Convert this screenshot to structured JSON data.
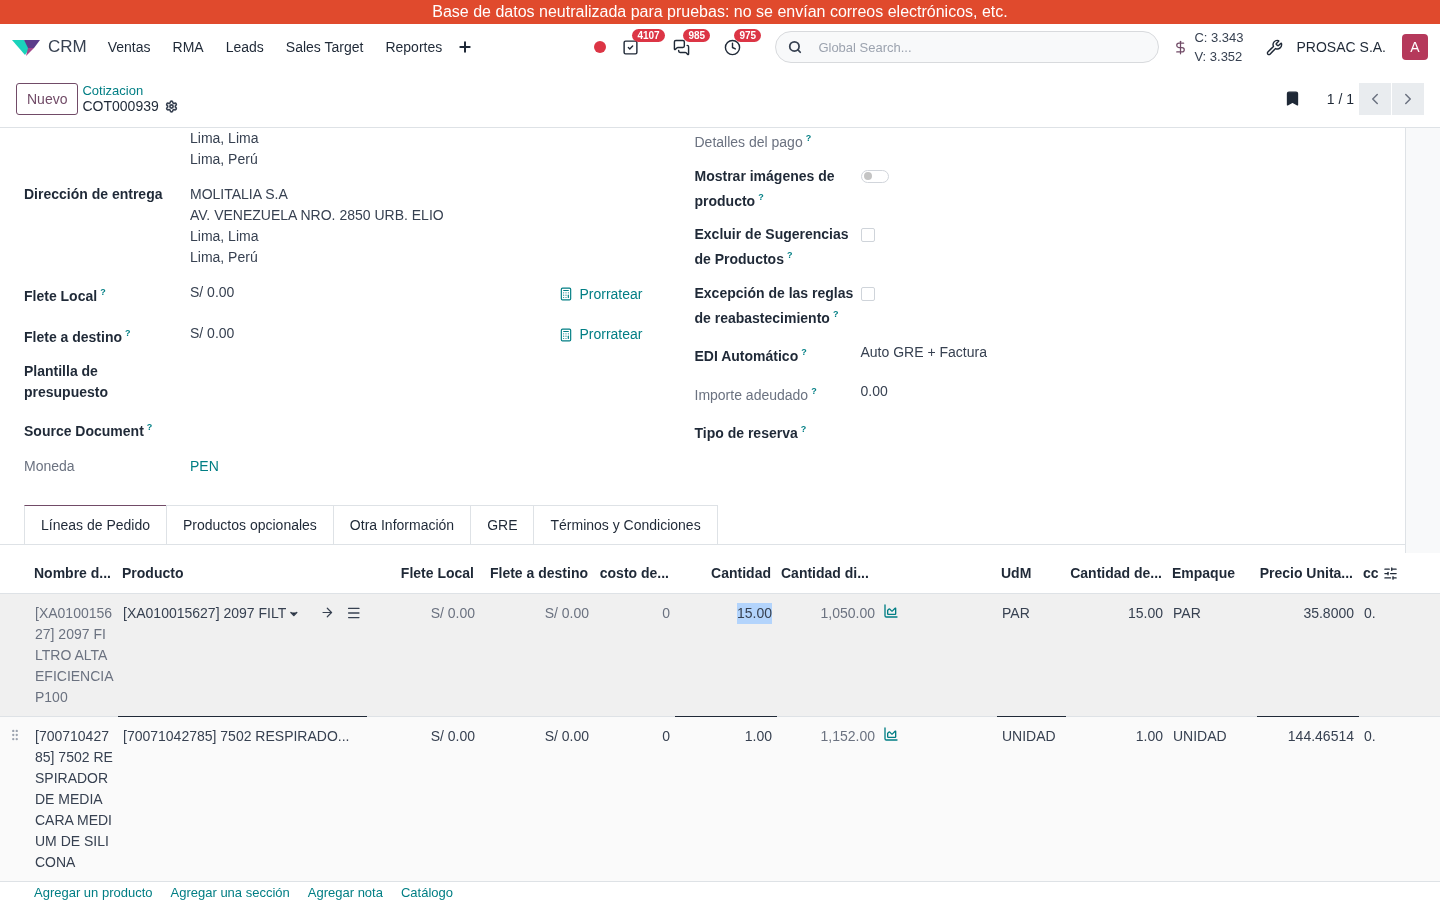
{
  "banner": "Base de datos neutralizada para pruebas: no se envían correos electrónicos, etc.",
  "navbar": {
    "app": "CRM",
    "menu": [
      "Ventas",
      "RMA",
      "Leads",
      "Sales Target",
      "Reportes"
    ],
    "badges": [
      {
        "kind": "activity",
        "count": "4107"
      },
      {
        "kind": "chat",
        "count": "985"
      },
      {
        "kind": "clock",
        "count": "975"
      }
    ],
    "search_placeholder": "Global Search...",
    "rates": [
      "C: 3.343",
      "V: 3.352"
    ],
    "company": "PROSAC S.A.",
    "avatar": "A"
  },
  "control_panel": {
    "new_button": "Nuevo",
    "breadcrumb": "Cotizacion",
    "record": "COT000939",
    "pager": "1 / 1"
  },
  "left_fields": [
    {
      "values": [
        "Lima, Lima",
        "Lima, Perú"
      ]
    },
    {
      "label": "Dirección de entrega",
      "values": [
        "MOLITALIA S.A",
        "AV. VENEZUELA NRO. 2850 URB. ELIO",
        "Lima, Lima",
        "Lima, Perú"
      ]
    },
    {
      "label": "Flete Local",
      "help": "?",
      "values": [
        "S/ 0.00"
      ],
      "action": "Prorratear"
    },
    {
      "label": "Flete a destino",
      "help": "?",
      "values": [
        "S/ 0.00"
      ],
      "action": "Prorratear"
    },
    {
      "label": "Plantilla de presupuesto"
    },
    {
      "label": "Source Document",
      "help": "?"
    },
    {
      "label": "Moneda",
      "readonly": true,
      "values": [
        "PEN"
      ],
      "link": true
    }
  ],
  "right_fields": [
    {
      "kind": "text",
      "label": "Detalles del pago",
      "help": "?",
      "readonly": true
    },
    {
      "kind": "toggle",
      "label": "Mostrar imágenes de producto",
      "help": "?",
      "on": false
    },
    {
      "kind": "checkbox",
      "label": "Excluir de Sugerencias de Productos",
      "help": "?",
      "checked": false
    },
    {
      "kind": "checkbox",
      "label": "Excepción de las reglas de reabastecimiento",
      "help": "?",
      "checked": false
    },
    {
      "kind": "text",
      "label": "EDI Automático",
      "help": "?",
      "value": "Auto GRE + Factura"
    },
    {
      "kind": "text",
      "label": "Importe adeudado",
      "help": "?",
      "readonly": true,
      "value": "0.00"
    },
    {
      "kind": "text",
      "label": "Tipo de reserva",
      "help": "?"
    }
  ],
  "tabs": [
    {
      "label": "Líneas de Pedido",
      "selected": true
    },
    {
      "label": "Productos opcionales",
      "selected": false
    },
    {
      "label": "Otra Información",
      "selected": false
    },
    {
      "label": "GRE",
      "selected": false
    },
    {
      "label": "Términos y Condiciones",
      "selected": false
    }
  ],
  "table": {
    "columns": [
      {
        "label": "Nombre d..."
      },
      {
        "label": "Producto"
      },
      {
        "label": "Flete Local"
      },
      {
        "label": "Flete a destino"
      },
      {
        "label": "costo de..."
      },
      {
        "label": "Cantidad"
      },
      {
        "label": "Cantidad di..."
      },
      {
        "label": "UdM"
      },
      {
        "label": "Cantidad de..."
      },
      {
        "label": "Empaque"
      },
      {
        "label": "Precio Unita..."
      },
      {
        "label": "cc"
      }
    ],
    "rows": [
      {
        "selected": true,
        "quantity_highlighted": true,
        "cells": [
          "[XA010015627] 2097 FILTRO ALTA EFICIENCIA P100",
          "[XA010015627] 2097 FILT",
          "S/ 0.00",
          "S/ 0.00",
          "0",
          "15.00",
          "1,050.00",
          "PAR",
          "15.00",
          "PAR",
          "35.8000",
          "0."
        ]
      },
      {
        "selected": false,
        "quantity_highlighted": false,
        "cells": [
          "[70071042785] 7502 RESPIRADOR DE MEDIA CARA MEDIUM DE SILICONA",
          "[70071042785] 7502 RESPIRADO...",
          "S/ 0.00",
          "S/ 0.00",
          "0",
          "1.00",
          "1,152.00",
          "UNIDAD",
          "1.00",
          "UNIDAD",
          "144.46514",
          "0."
        ]
      }
    ]
  },
  "footer_links": [
    "Agregar un producto",
    "Agregar una sección",
    "Agregar nota",
    "Catálogo"
  ]
}
